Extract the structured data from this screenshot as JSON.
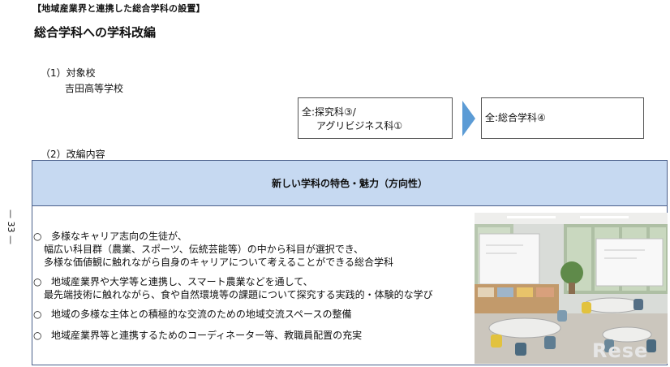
{
  "header_tag": "【地域産業界と連携した総合学科の設置】",
  "main_title": "総合学科への学科改編",
  "section1": {
    "heading": "（1）対象校",
    "school": "吉田高等学校"
  },
  "transition": {
    "before_line1": "全:探究科③/",
    "before_line2": "アグリビジネス科①",
    "after": "全:総合学科④"
  },
  "section2": {
    "heading": "（2）改編内容"
  },
  "banner": {
    "title": "新しい学科の特色・魅力（方向性）"
  },
  "bullets": {
    "mark": "○",
    "b1_l1": "多様なキャリア志向の生徒が、",
    "b1_l2": "幅広い科目群（農業、スポーツ、伝統芸能等）の中から科目が選択でき、",
    "b1_l3": "多様な価値観に触れながら自身のキャリアについて考えることができる総合学科",
    "b2_l1": "地域産業界や大学等と連携し、スマート農業などを通して、",
    "b2_l2": "最先端技術に触れながら、食や自然環境等の課題について探究する実践的・体験的な学び",
    "b3_l1": "地域の多様な主体との積極的な交流のための地域交流スペースの整備",
    "b4_l1": "地域産業界等と連携するためのコーディネーター等、教職員配置の充実"
  },
  "page_number": "— 33 —",
  "watermark": "Rese",
  "colors": {
    "banner_bg": "#c6d9f1",
    "arrow": "#5b9bd5",
    "border": "#4a5f8a"
  }
}
